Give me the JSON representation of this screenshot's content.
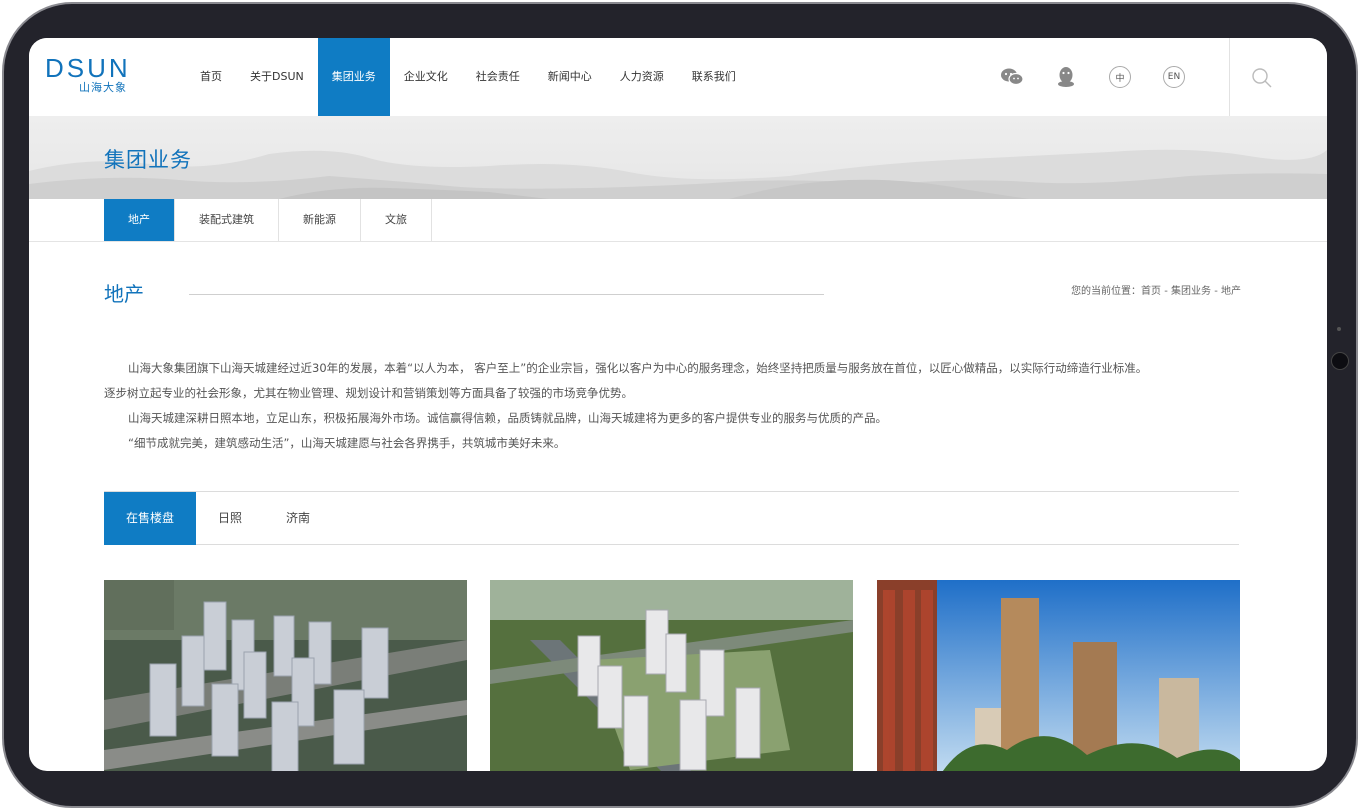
{
  "logo": {
    "main": "DSUN",
    "sub": "山海大象"
  },
  "nav": {
    "items": [
      "首页",
      "关于DSUN",
      "集团业务",
      "企业文化",
      "社会责任",
      "新闻中心",
      "人力资源",
      "联系我们"
    ],
    "active_index": 2
  },
  "header_icons": {
    "wechat": "wechat-icon",
    "qq": "qq-icon",
    "lang_cn": "中",
    "lang_en": "EN"
  },
  "banner": {
    "title": "集团业务"
  },
  "subtabs": {
    "items": [
      "地产",
      "装配式建筑",
      "新能源",
      "文旅"
    ],
    "active_index": 0
  },
  "section": {
    "title": "地产",
    "breadcrumb": "您的当前位置：首页 - 集团业务 - 地产"
  },
  "intro": {
    "p1": "山海大象集团旗下山海天城建经过近30年的发展，本着“以人为本， 客户至上”的企业宗旨，强化以客户为中心的服务理念，始终坚持把质量与服务放在首位，以匠心做精品，以实际行动缔造行业标准。",
    "p1b": "逐步树立起专业的社会形象，尤其在物业管理、规划设计和营销策划等方面具备了较强的市场竞争优势。",
    "p2": "山海天城建深耕日照本地，立足山东，积极拓展海外市场。诚信赢得信赖，品质铸就品牌，山海天城建将为更多的客户提供专业的服务与优质的产品。",
    "p3": "“细节成就完美，建筑感动生活”，山海天城建愿与社会各界携手，共筑城市美好未来。"
  },
  "filter_tabs": {
    "items": [
      "在售楼盘",
      "日照",
      "济南"
    ],
    "active_index": 0
  },
  "colors": {
    "brand": "#0f7cc4",
    "text": "#555555",
    "bezel": "#23232b"
  }
}
